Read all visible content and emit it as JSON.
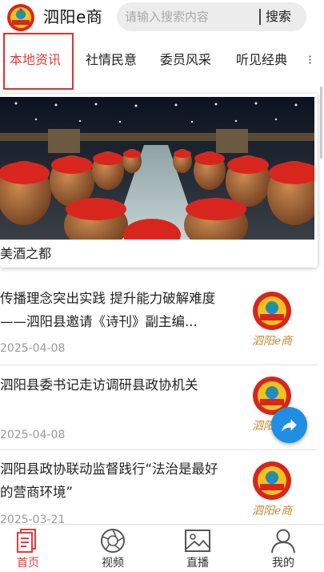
{
  "header": {
    "app_title": "泗阳e商",
    "search": {
      "placeholder": "请输入搜索内容",
      "button_label": "搜索"
    }
  },
  "tabs": [
    {
      "label": "本地资讯",
      "active": true
    },
    {
      "label": "社情民意",
      "active": false
    },
    {
      "label": "委员风采",
      "active": false
    },
    {
      "label": "听见经典",
      "active": false
    }
  ],
  "tab_more_glyph": "⁝",
  "banner": {
    "caption": "美酒之都"
  },
  "news": [
    {
      "title": "传播理念突出实践 提升能力破解难度——泗阳县邀请《诗刊》副主编...",
      "date": "2025-04-08",
      "thumb_caption": "泗阳e商"
    },
    {
      "title": "泗阳县委书记走访调研县政协机关",
      "date": "2025-04-08",
      "thumb_caption": "泗阳e商"
    },
    {
      "title": "泗阳县政协联动监督践行“法治是最好的营商环境”",
      "date": "2025-03-21",
      "thumb_caption": "泗阳e商"
    }
  ],
  "bottom_nav": [
    {
      "label": "首页",
      "icon": "home-document-icon",
      "active": true
    },
    {
      "label": "视频",
      "icon": "camera-aperture-icon",
      "active": false
    },
    {
      "label": "直播",
      "icon": "image-icon",
      "active": false
    },
    {
      "label": "我的",
      "icon": "user-icon",
      "active": false
    }
  ],
  "colors": {
    "accent": "#e23b3b",
    "highlight_border": "#e4302f",
    "fab": "#1f8fe3",
    "date": "#9a9a9a"
  }
}
